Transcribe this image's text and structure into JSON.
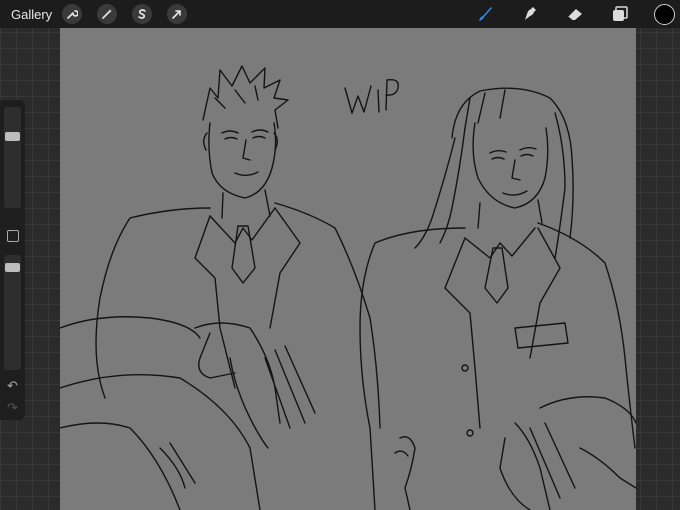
{
  "topbar": {
    "gallery_label": "Gallery",
    "left_tools": [
      {
        "name": "actions",
        "icon": "wrench-icon"
      },
      {
        "name": "adjustments",
        "icon": "magic-wand-icon"
      },
      {
        "name": "selection",
        "icon": "selection-s-icon"
      },
      {
        "name": "transform",
        "icon": "arrow-cursor-icon"
      }
    ],
    "right_tools": [
      {
        "name": "brush",
        "icon": "brush-icon",
        "active": true
      },
      {
        "name": "smudge",
        "icon": "smudge-icon"
      },
      {
        "name": "eraser",
        "icon": "eraser-icon"
      },
      {
        "name": "layers",
        "icon": "layers-icon"
      }
    ],
    "accent_color": "#2f8cf0",
    "current_color": "#000000"
  },
  "sidebar": {
    "brush_size_level": 0.82,
    "opacity_level": 0.98,
    "undo_icon": "undo-icon",
    "redo_icon": "redo-icon"
  },
  "canvas": {
    "background": "#7b7b7b",
    "annotation_text": "WIP"
  }
}
